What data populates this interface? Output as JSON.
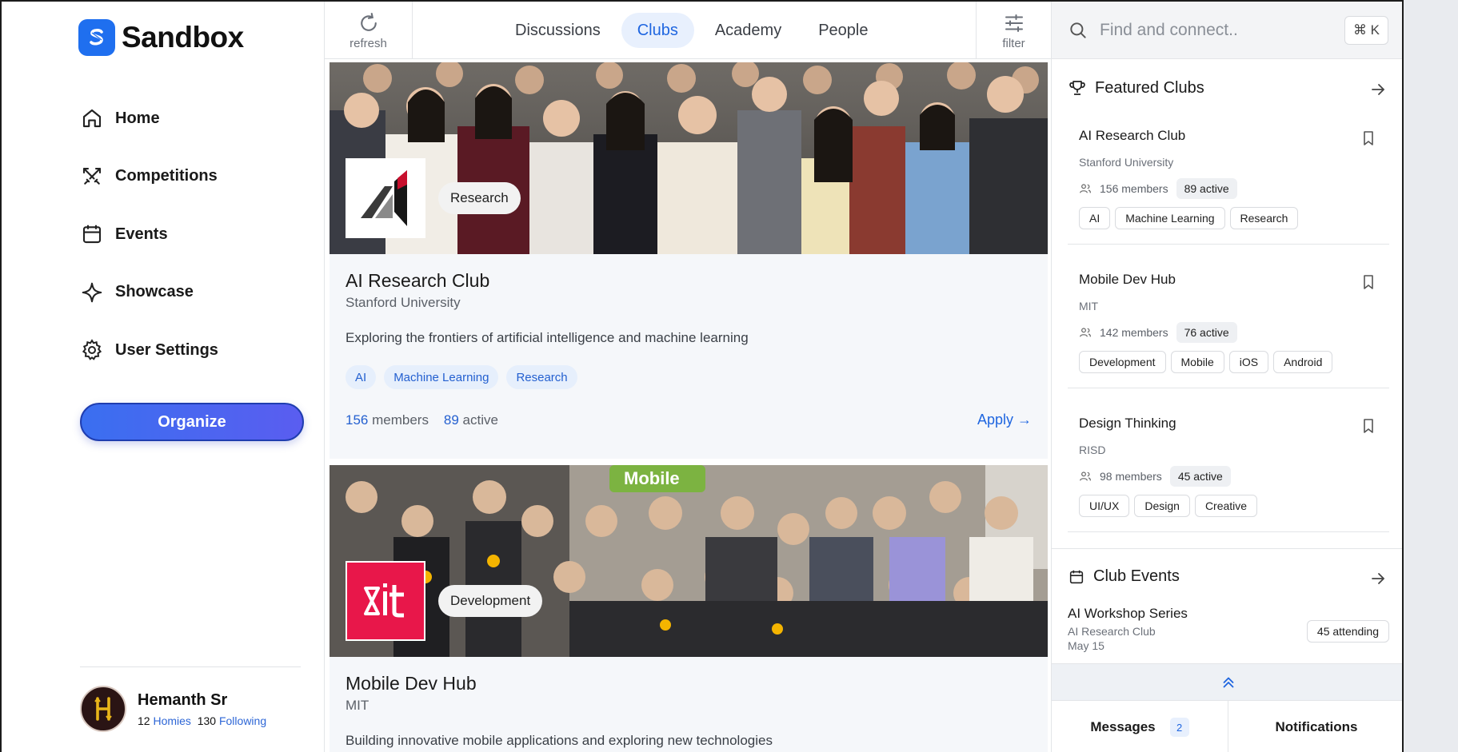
{
  "app": {
    "name": "Sandbox"
  },
  "sidebar": {
    "items": [
      {
        "label": "Home",
        "icon": "home-icon"
      },
      {
        "label": "Competitions",
        "icon": "swords-icon"
      },
      {
        "label": "Events",
        "icon": "calendar-icon"
      },
      {
        "label": "Showcase",
        "icon": "sparkle-icon"
      },
      {
        "label": "User Settings",
        "icon": "gear-icon"
      }
    ],
    "organize_label": "Organize",
    "user": {
      "name": "Hemanth Sr",
      "homies_count": "12",
      "homies_label": "Homies",
      "following_count": "130",
      "following_label": "Following"
    }
  },
  "topbar": {
    "refresh_label": "refresh",
    "filter_label": "filter",
    "tabs": [
      {
        "label": "Discussions",
        "active": false
      },
      {
        "label": "Clubs",
        "active": true
      },
      {
        "label": "Academy",
        "active": false
      },
      {
        "label": "People",
        "active": false
      }
    ]
  },
  "feed": {
    "clubs": [
      {
        "category": "Research",
        "name": "AI Research Club",
        "university": "Stanford University",
        "description": "Exploring the frontiers of artificial intelligence and machine learning",
        "tags": [
          "AI",
          "Machine Learning",
          "Research"
        ],
        "members": "156",
        "members_label": "members",
        "active": "89",
        "active_label": "active",
        "apply_label": "Apply →"
      },
      {
        "category": "Development",
        "name": "Mobile Dev Hub",
        "university": "MIT",
        "description": "Building innovative mobile applications and exploring new technologies"
      }
    ]
  },
  "right": {
    "search": {
      "placeholder": "Find and connect..",
      "shortcut": "⌘ K"
    },
    "featured": {
      "title": "Featured Clubs",
      "clubs": [
        {
          "name": "AI Research Club",
          "university": "Stanford University",
          "members": "156 members",
          "active": "89 active",
          "tags": [
            "AI",
            "Machine Learning",
            "Research"
          ]
        },
        {
          "name": "Mobile Dev Hub",
          "university": "MIT",
          "members": "142 members",
          "active": "76 active",
          "tags": [
            "Development",
            "Mobile",
            "iOS",
            "Android"
          ]
        },
        {
          "name": "Design Thinking",
          "university": "RISD",
          "members": "98 members",
          "active": "45 active",
          "tags": [
            "UI/UX",
            "Design",
            "Creative"
          ]
        }
      ]
    },
    "events": {
      "title": "Club Events",
      "items": [
        {
          "name": "AI Workshop Series",
          "club": "AI Research Club",
          "date": "May 15",
          "attending": "45 attending"
        }
      ]
    },
    "bottom": {
      "messages_label": "Messages",
      "messages_count": "2",
      "notifications_label": "Notifications"
    }
  },
  "colors": {
    "accent": "#1f66e0",
    "brand": "#1f6fef",
    "organize_gradient_start": "#3a6ff0",
    "organize_gradient_end": "#5a5df0"
  }
}
